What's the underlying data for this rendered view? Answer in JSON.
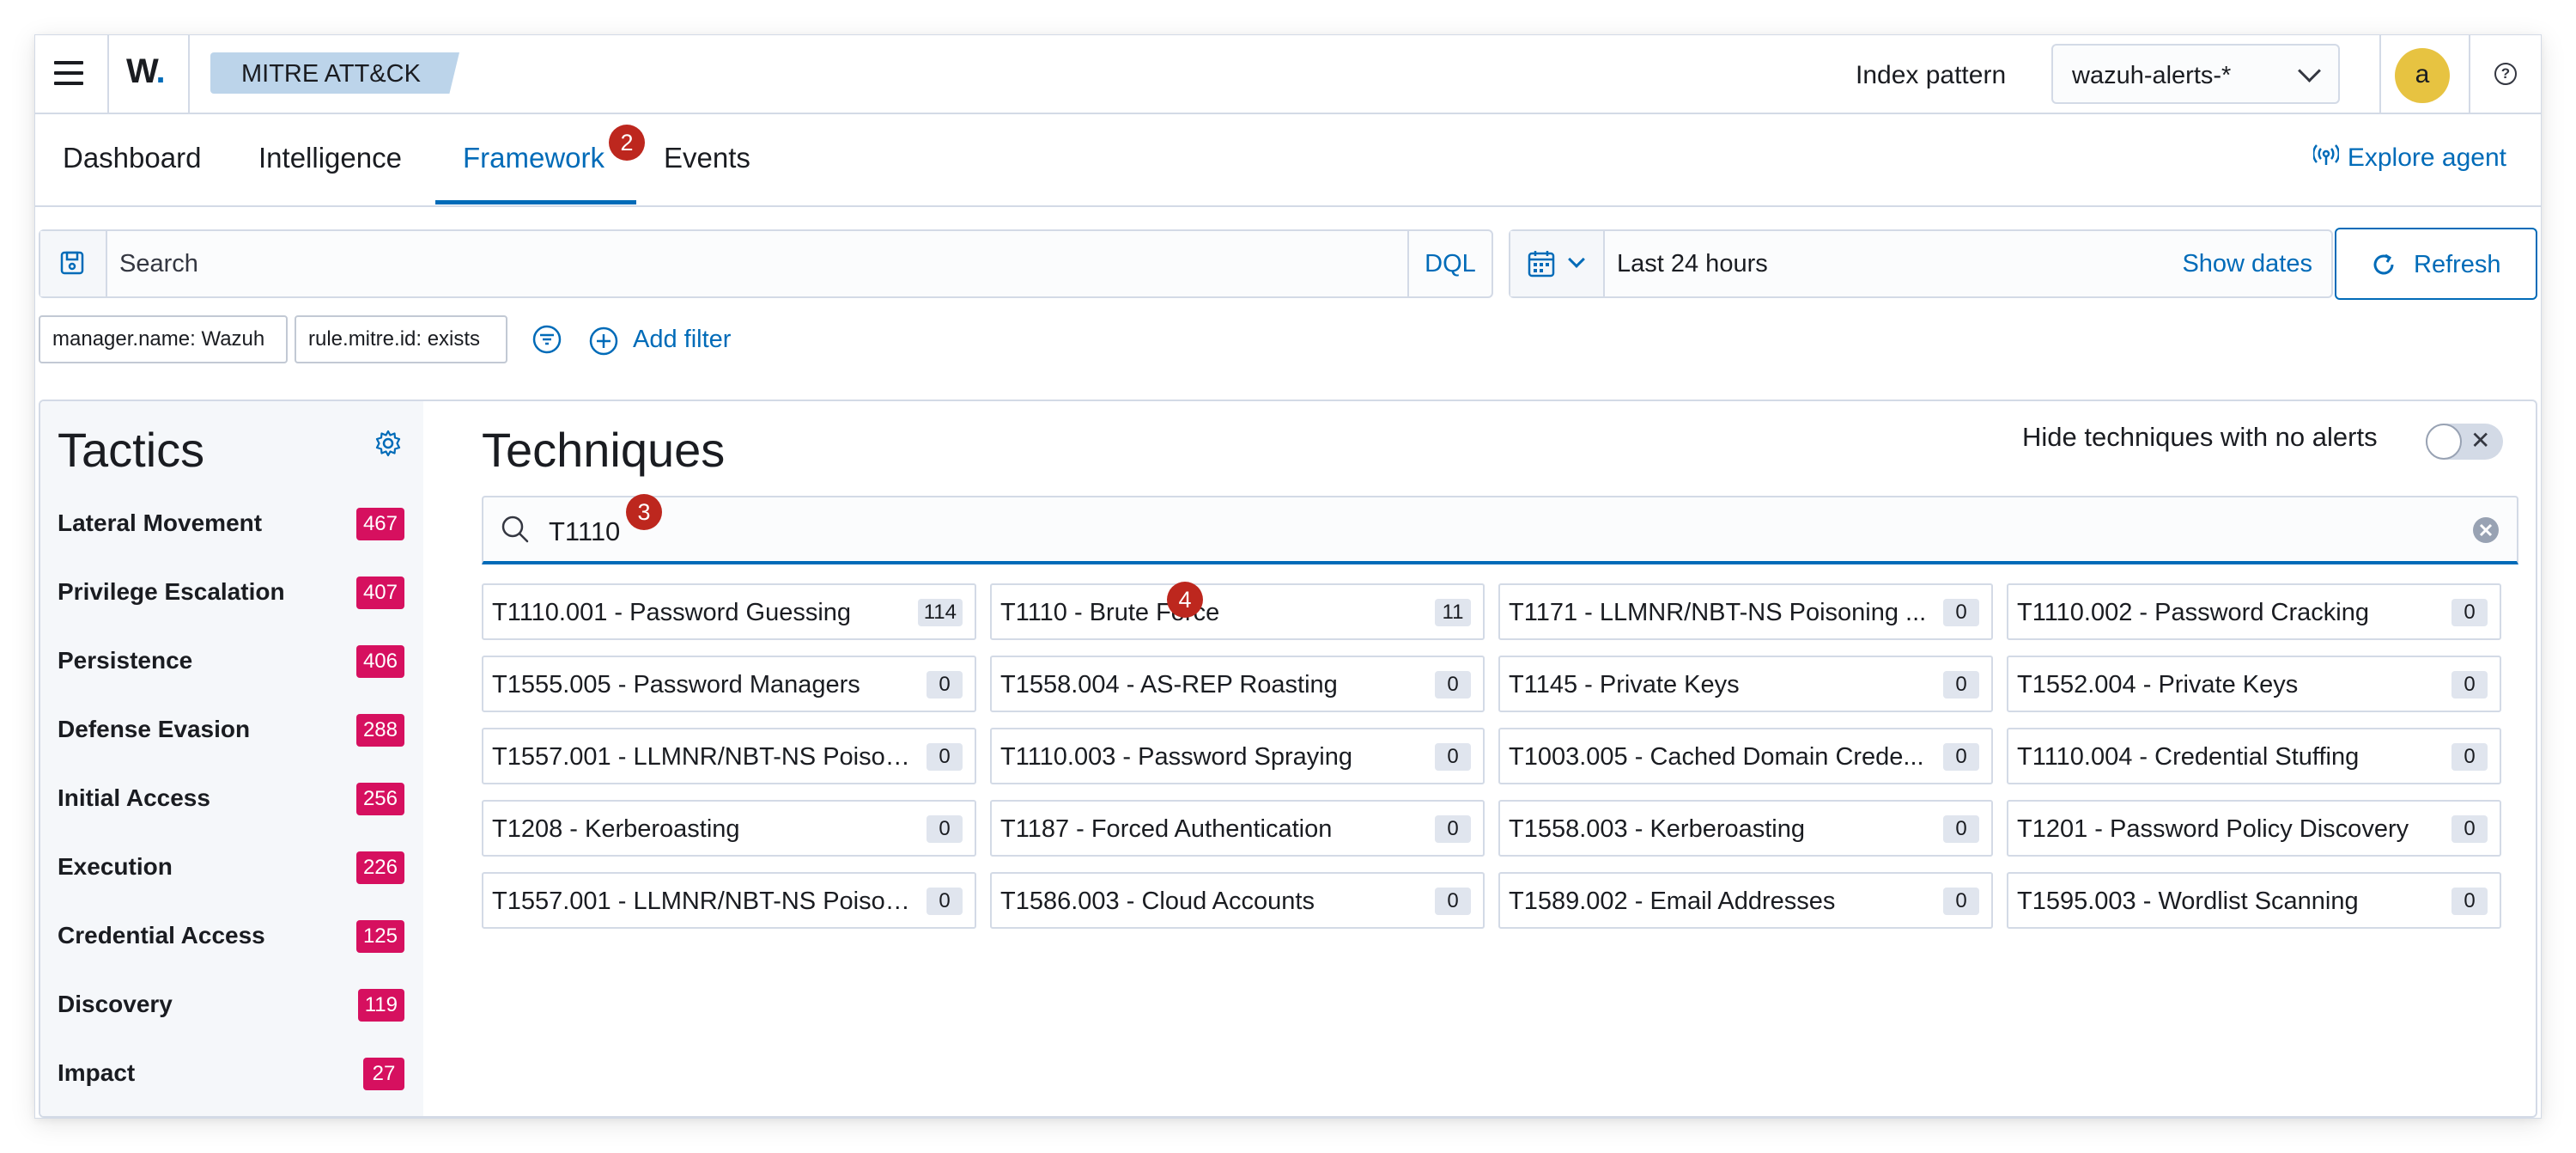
{
  "header": {
    "logo": "W",
    "breadcrumb": "MITRE ATT&CK",
    "index_pattern_label": "Index pattern",
    "index_pattern_value": "wazuh-alerts-*",
    "avatar_initial": "a",
    "help_glyph": "?"
  },
  "tabs": [
    {
      "label": "Dashboard"
    },
    {
      "label": "Intelligence"
    },
    {
      "label": "Framework",
      "active": true
    },
    {
      "label": "Events"
    }
  ],
  "explore_agent": "Explore agent",
  "annotations": {
    "tabs": "2",
    "search": "3",
    "technique": "4"
  },
  "query": {
    "placeholder": "Search",
    "language": "DQL",
    "date_range": "Last 24 hours",
    "show_dates": "Show dates",
    "refresh": "Refresh"
  },
  "filters": {
    "pills": [
      "manager.name: Wazuh",
      "rule.mitre.id: exists"
    ],
    "add_filter": "Add filter"
  },
  "tactics": {
    "title": "Tactics",
    "items": [
      {
        "name": "Lateral Movement",
        "count": "467"
      },
      {
        "name": "Privilege Escalation",
        "count": "407"
      },
      {
        "name": "Persistence",
        "count": "406"
      },
      {
        "name": "Defense Evasion",
        "count": "288"
      },
      {
        "name": "Initial Access",
        "count": "256"
      },
      {
        "name": "Execution",
        "count": "226"
      },
      {
        "name": "Credential Access",
        "count": "125"
      },
      {
        "name": "Discovery",
        "count": "119"
      },
      {
        "name": "Impact",
        "count": "27"
      }
    ]
  },
  "techniques": {
    "title": "Techniques",
    "hide_label": "Hide techniques with no alerts",
    "search_value": "T1110",
    "items": [
      {
        "name": "T1110.001 - Password Guessing",
        "count": "114"
      },
      {
        "name": "T1110 - Brute Force",
        "count": "11"
      },
      {
        "name": "T1171 - LLMNR/NBT-NS Poisoning ...",
        "count": "0"
      },
      {
        "name": "T1110.002 - Password Cracking",
        "count": "0"
      },
      {
        "name": "T1555.005 - Password Managers",
        "count": "0"
      },
      {
        "name": "T1558.004 - AS-REP Roasting",
        "count": "0"
      },
      {
        "name": "T1145 - Private Keys",
        "count": "0"
      },
      {
        "name": "T1552.004 - Private Keys",
        "count": "0"
      },
      {
        "name": "T1557.001 - LLMNR/NBT-NS Poison...",
        "count": "0"
      },
      {
        "name": "T1110.003 - Password Spraying",
        "count": "0"
      },
      {
        "name": "T1003.005 - Cached Domain Crede...",
        "count": "0"
      },
      {
        "name": "T1110.004 - Credential Stuffing",
        "count": "0"
      },
      {
        "name": "T1208 - Kerberoasting",
        "count": "0"
      },
      {
        "name": "T1187 - Forced Authentication",
        "count": "0"
      },
      {
        "name": "T1558.003 - Kerberoasting",
        "count": "0"
      },
      {
        "name": "T1201 - Password Policy Discovery",
        "count": "0"
      },
      {
        "name": "T1557.001 - LLMNR/NBT-NS Poison...",
        "count": "0"
      },
      {
        "name": "T1586.003 - Cloud Accounts",
        "count": "0"
      },
      {
        "name": "T1589.002 - Email Addresses",
        "count": "0"
      },
      {
        "name": "T1595.003 - Wordlist Scanning",
        "count": "0"
      }
    ]
  },
  "colors": {
    "accent": "#006bb8",
    "tactic_badge": "#d6105f",
    "annotation_badge": "#bd271e",
    "breadcrumb_bg": "#bcd4ea",
    "avatar_bg": "#e7c341"
  }
}
